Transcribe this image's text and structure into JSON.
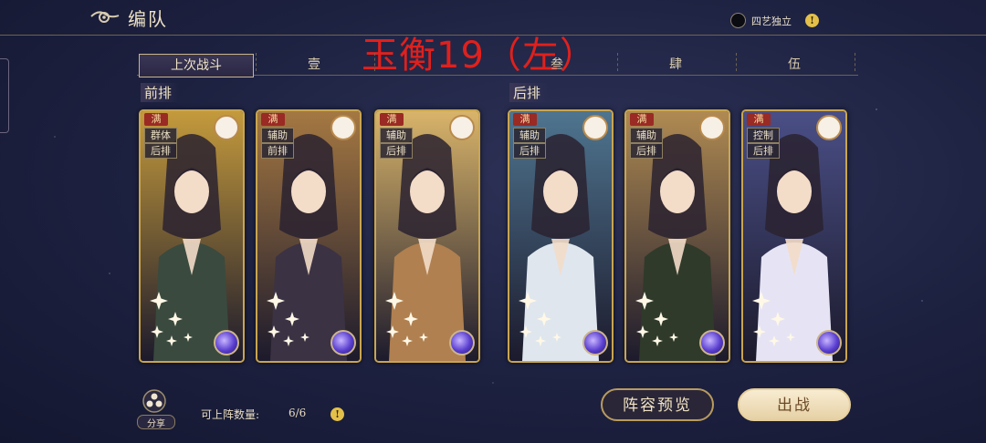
{
  "header": {
    "title": "编队",
    "toggle_label": "四艺独立",
    "help_symbol": "!"
  },
  "overlay_title": "玉衡19（左）",
  "tabs": [
    {
      "label": "上次战斗",
      "active": true
    },
    {
      "label": "壹",
      "active": false
    },
    {
      "label": "叁",
      "active": false
    },
    {
      "label": "肆",
      "active": false
    },
    {
      "label": "伍",
      "active": false
    }
  ],
  "rows": {
    "front_label": "前排",
    "back_label": "后排"
  },
  "cards": [
    {
      "full_badge": "满",
      "tags": [
        "群体",
        "后排"
      ],
      "palette": [
        "#c49a3c",
        "#3a4a3e"
      ],
      "pet": "pink-pig-pet-icon"
    },
    {
      "full_badge": "满",
      "tags": [
        "辅助",
        "前排"
      ],
      "palette": [
        "#a57842",
        "#3b3244"
      ],
      "pet": "white-creature-pet-icon"
    },
    {
      "full_badge": "满",
      "tags": [
        "辅助",
        "后排"
      ],
      "palette": [
        "#d9b46a",
        "#b08050"
      ],
      "pet": "brown-bird-pet-icon"
    },
    {
      "full_badge": "满",
      "tags": [
        "辅助",
        "后排"
      ],
      "palette": [
        "#4f7590",
        "#dfe6ee"
      ],
      "pet": "white-horse-pet-icon"
    },
    {
      "full_badge": "满",
      "tags": [
        "辅助",
        "后排"
      ],
      "palette": [
        "#b08a52",
        "#2f3a2a"
      ],
      "pet": "white-bird-pet-icon"
    },
    {
      "full_badge": "满",
      "tags": [
        "控制",
        "后排"
      ],
      "palette": [
        "#4a4f86",
        "#e6e4f4"
      ],
      "pet": "orange-fox-pet-icon"
    }
  ],
  "bottom": {
    "share_label": "分享",
    "count_label": "可上阵数量:",
    "count_value": "6/6",
    "preview_button": "阵容预览",
    "battle_button": "出战"
  },
  "colors": {
    "overlay_red": "#e0201c",
    "card_border_gold": "#c9a550",
    "badge_red": "#9a2a24"
  }
}
